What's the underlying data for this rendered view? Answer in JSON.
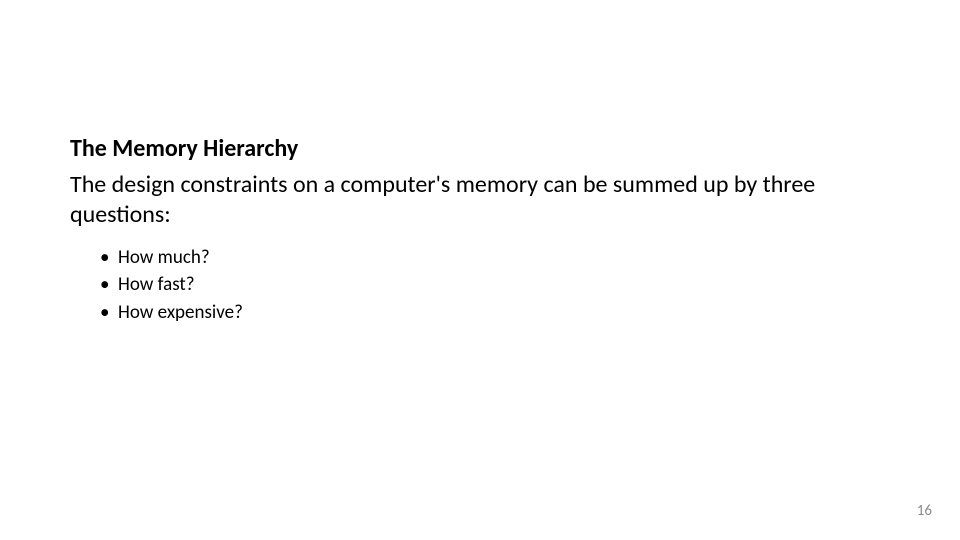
{
  "slide": {
    "heading": "The Memory Hierarchy",
    "subheading": "The design constraints on a computer's memory can be summed up by three questions:",
    "bullets": [
      "How much?",
      "How fast?",
      "How expensive?"
    ],
    "page_number": "16"
  }
}
